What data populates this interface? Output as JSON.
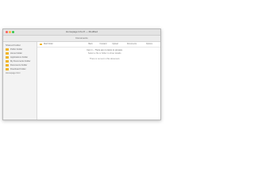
{
  "window": {
    "title": "Homepage Info.rtf — Modified",
    "toolbar_title": "Documents"
  },
  "sidebar": {
    "header": "Shared Folder",
    "items": [
      {
        "label": "Public Folder"
      },
      {
        "label": "Home Folder"
      },
      {
        "label": "Applications Folder"
      },
      {
        "label": "My Documents Folder"
      },
      {
        "label": "Documents Folder"
      },
      {
        "label": "Download Folder"
      }
    ],
    "extra": "Homepage.html"
  },
  "main": {
    "title": "Mail folder",
    "toolbar_buttons": [
      "Back",
      "Forward",
      "Upload",
      "Documents",
      "Options"
    ],
    "message_lines": [
      "Item 1 – There are no items to preview.",
      "Select a file or folder to show details.",
      "",
      "There is no text in this document."
    ]
  },
  "colors": {
    "folder": "#f0b429",
    "close": "#fc605c",
    "minimize": "#fcbb40",
    "maximize": "#34c84a"
  }
}
